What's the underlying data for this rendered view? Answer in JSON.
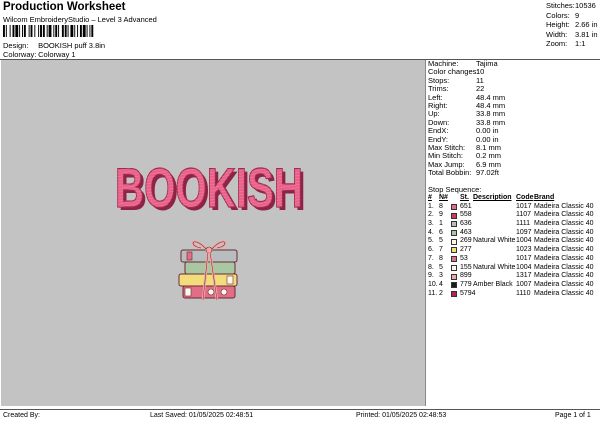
{
  "header": {
    "title": "Production Worksheet",
    "software": "Wilcom EmbroideryStudio – Level 3 Advanced",
    "design_label": "Design:",
    "design_value": "BOOKISH puff 3.8in",
    "colorway_label": "Colorway:",
    "colorway_value": "Colorway 1"
  },
  "top_stats": [
    {
      "label": "Stitches:",
      "value": "10536"
    },
    {
      "label": "Colors:",
      "value": "9"
    },
    {
      "label": "Height:",
      "value": "2.66 in"
    },
    {
      "label": "Width:",
      "value": "3.81 in"
    },
    {
      "label": "Zoom:",
      "value": "1:1"
    }
  ],
  "design": {
    "text": "BOOKISH",
    "text_color": "#e8628a",
    "text_outline": "#a22a52",
    "canvas_color": "#c3c3c3"
  },
  "properties": [
    {
      "label": "Machine:",
      "value": "Tajima"
    },
    {
      "label": "Color changes:",
      "value": "10"
    },
    {
      "label": "Stops:",
      "value": "11"
    },
    {
      "label": "Trims:",
      "value": "22"
    },
    {
      "label": "Left:",
      "value": "48.4 mm"
    },
    {
      "label": "Right:",
      "value": "48.4 mm"
    },
    {
      "label": "Up:",
      "value": "33.8 mm"
    },
    {
      "label": "Down:",
      "value": "33.8 mm"
    },
    {
      "label": "EndX:",
      "value": "0.00 in"
    },
    {
      "label": "EndY:",
      "value": "0.00 in"
    },
    {
      "label": "Max Stitch:",
      "value": "8.1 mm"
    },
    {
      "label": "Min Stitch:",
      "value": "0.2 mm"
    },
    {
      "label": "Max Jump:",
      "value": "6.9 mm"
    },
    {
      "label": "Total Bobbin:",
      "value": "97.02ft"
    }
  ],
  "sequence": {
    "title": "Stop Sequence:",
    "headers": {
      "num": "#",
      "n": "N#",
      "st": "St.",
      "desc": "Description",
      "code": "Code",
      "brand": "Brand"
    },
    "rows": [
      {
        "num": "1.",
        "n": "8",
        "color": "#e26d86",
        "st": "651",
        "desc": "",
        "code": "1017",
        "brand": "Madeira Classic 40"
      },
      {
        "num": "2.",
        "n": "9",
        "color": "#d03a5a",
        "st": "558",
        "desc": "",
        "code": "1107",
        "brand": "Madeira Classic 40"
      },
      {
        "num": "3.",
        "n": "1",
        "color": "#b8bdbf",
        "st": "636",
        "desc": "",
        "code": "1111",
        "brand": "Madeira Classic 40"
      },
      {
        "num": "4.",
        "n": "6",
        "color": "#a9c7a2",
        "st": "463",
        "desc": "",
        "code": "1097",
        "brand": "Madeira Classic 40"
      },
      {
        "num": "5.",
        "n": "5",
        "color": "#fbf7ec",
        "st": "269",
        "desc": "Natural White",
        "code": "1004",
        "brand": "Madeira Classic 40"
      },
      {
        "num": "6.",
        "n": "7",
        "color": "#f2dc7c",
        "st": "277",
        "desc": "",
        "code": "1023",
        "brand": "Madeira Classic 40"
      },
      {
        "num": "7.",
        "n": "8",
        "color": "#e26d86",
        "st": "53",
        "desc": "",
        "code": "1017",
        "brand": "Madeira Classic 40"
      },
      {
        "num": "8.",
        "n": "5",
        "color": "#fbf7ec",
        "st": "155",
        "desc": "Natural White",
        "code": "1004",
        "brand": "Madeira Classic 40"
      },
      {
        "num": "9.",
        "n": "3",
        "color": "#f2a7a3",
        "st": "899",
        "desc": "",
        "code": "1317",
        "brand": "Madeira Classic 40"
      },
      {
        "num": "10.",
        "n": "4",
        "color": "#1a1a1a",
        "st": "779",
        "desc": "Amber Black",
        "code": "1007",
        "brand": "Madeira Classic 40"
      },
      {
        "num": "11.",
        "n": "2",
        "color": "#b0245a",
        "st": "5794",
        "desc": "",
        "code": "1110",
        "brand": "Madeira Classic 40"
      }
    ]
  },
  "footer": {
    "created": "Created By:",
    "saved": "Last Saved: 01/05/2025 02:48:51",
    "printed": "Printed: 01/05/2025 02:48:53",
    "page": "Page 1 of 1"
  }
}
